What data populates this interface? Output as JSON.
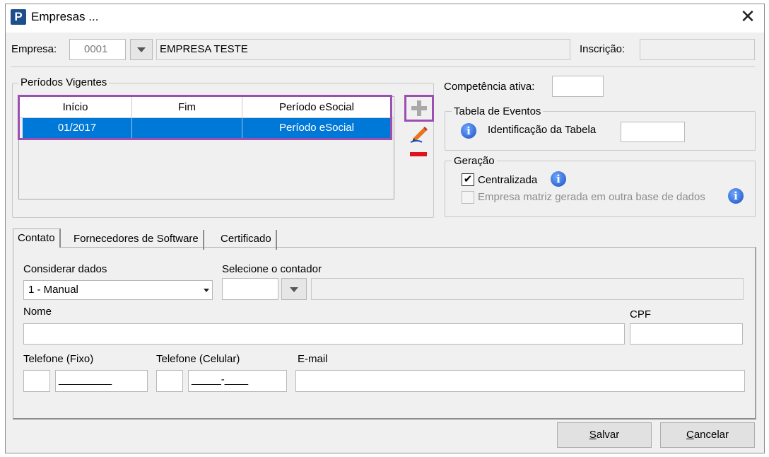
{
  "window": {
    "title": "Empresas ...",
    "app_icon_letter": "P"
  },
  "empresa": {
    "label": "Empresa:",
    "code": "0001",
    "name": "EMPRESA TESTE",
    "inscricao_label": "Inscrição:",
    "inscricao_value": ""
  },
  "periodos": {
    "legend": "Períodos Vigentes",
    "columns": [
      "Início",
      "Fim",
      "Período eSocial"
    ],
    "rows": [
      {
        "inicio": "01/2017",
        "fim": "",
        "periodo": "Período eSocial"
      }
    ]
  },
  "competencia": {
    "label": "Competência ativa:",
    "value": ""
  },
  "tabela_eventos": {
    "legend": "Tabela de Eventos",
    "label": "Identificação da Tabela",
    "value": ""
  },
  "geracao": {
    "legend": "Geração",
    "centralizada": {
      "label": "Centralizada",
      "checked": true
    },
    "matriz": {
      "label": "Empresa matriz gerada em outra base de dados",
      "checked": false
    }
  },
  "tabs": [
    "Contato",
    "Fornecedores de Software",
    "Certificado"
  ],
  "contato": {
    "considerar_label": "Considerar dados",
    "considerar_value": "1 - Manual",
    "contador_label": "Selecione o contador",
    "nome_label": "Nome",
    "cpf_label": "CPF",
    "tel_fixo_label": "Telefone (Fixo)",
    "tel_fixo_mask": "_________",
    "tel_cel_label": "Telefone (Celular)",
    "tel_cel_mask": "_____-____",
    "email_label": "E-mail"
  },
  "buttons": {
    "save_key": "S",
    "save_rest": "alvar",
    "cancel_key": "C",
    "cancel_rest": "ancelar"
  },
  "icons": {
    "add": "plus-icon",
    "edit": "pencil-icon",
    "remove": "minus-icon",
    "info": "info-icon",
    "close": "close-icon"
  },
  "colors": {
    "selection": "#0078d7",
    "highlight": "#9b4fb0",
    "remove": "#e0121b"
  }
}
